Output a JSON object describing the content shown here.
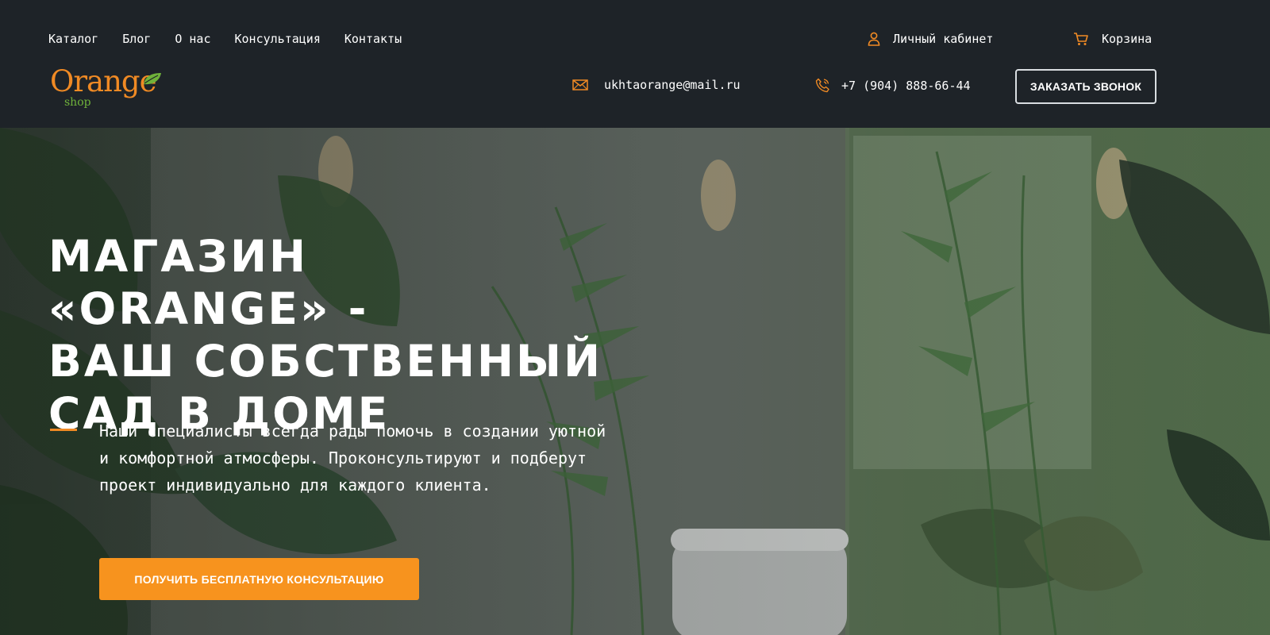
{
  "nav": {
    "items": [
      {
        "label": "Каталог"
      },
      {
        "label": "Блог"
      },
      {
        "label": "О нас"
      },
      {
        "label": "Консультация"
      },
      {
        "label": "Контакты"
      }
    ]
  },
  "account": {
    "label": "Личный кабинет",
    "icon": "user-icon"
  },
  "cart": {
    "label": "Корзина",
    "icon": "cart-icon"
  },
  "logo": {
    "word": "Orange",
    "sub": "shop"
  },
  "contacts": {
    "email": "ukhtaorange@mail.ru",
    "phone": "+7 (904) 888-66-44"
  },
  "callback_label": "ЗАКАЗАТЬ ЗВОНОК",
  "hero": {
    "title_lines": [
      "МАГАЗИН «ORANGE» -",
      "ВАШ СОБСТВЕННЫЙ",
      "САД В ДОМЕ"
    ],
    "description": "Наши специалисты всегда рады помочь в создании уютной и комфортной атмосферы. Проконсультируют и подберут проект индивидуально для каждого клиента.",
    "cta_label": "ПОЛУЧИТЬ БЕСПЛАТНУЮ КОНСУЛЬТАЦИЮ"
  },
  "colors": {
    "accent": "#f7931e",
    "header_bg": "#1e2328",
    "logo_green": "#6fb23a"
  }
}
